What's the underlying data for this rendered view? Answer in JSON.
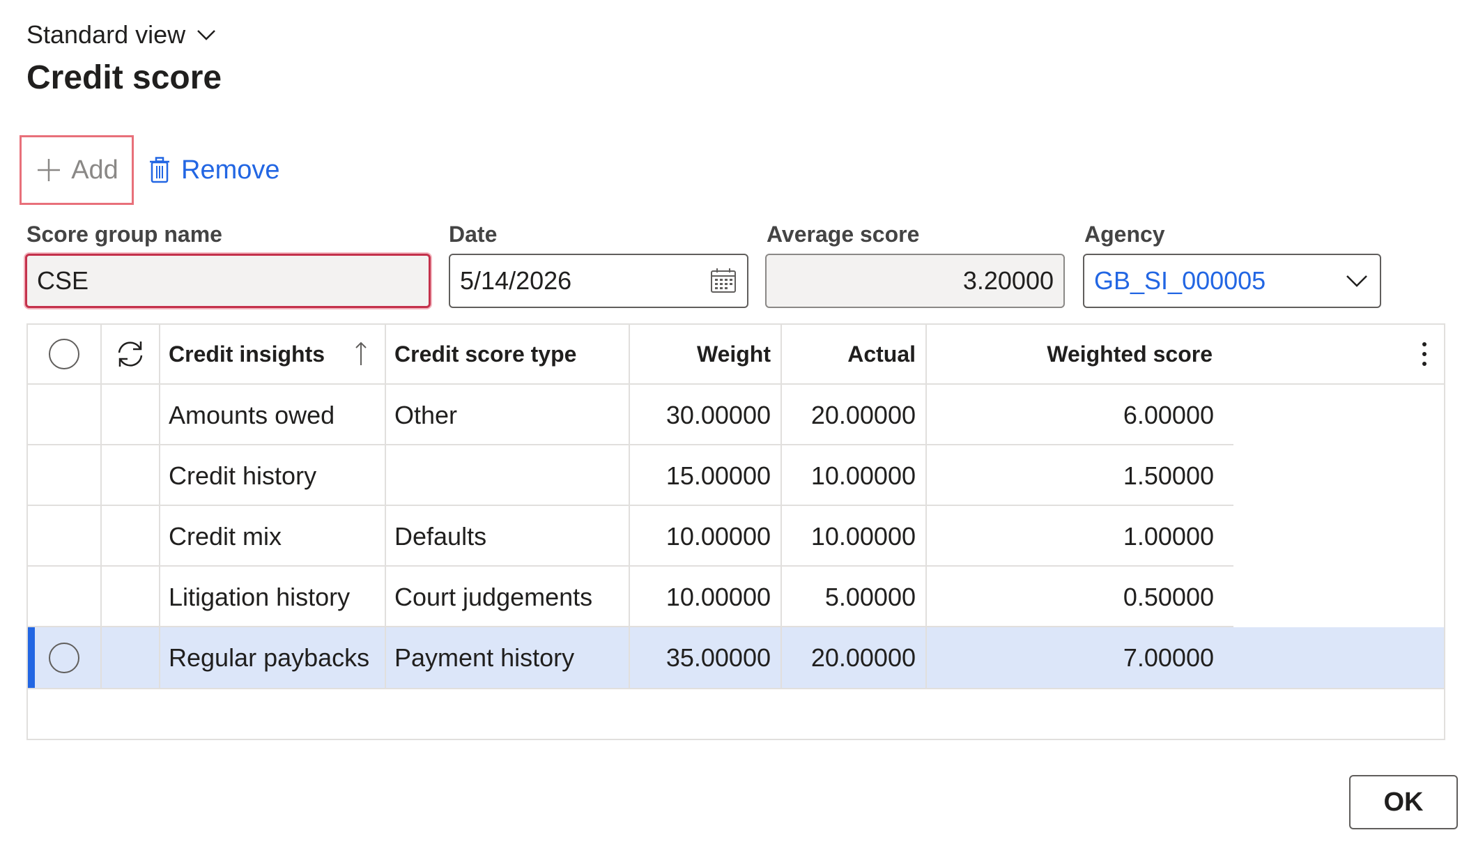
{
  "header": {
    "view_label": "Standard view",
    "title": "Credit score"
  },
  "toolbar": {
    "add_label": "Add",
    "remove_label": "Remove"
  },
  "fields": {
    "score_group_name": {
      "label": "Score group name",
      "value": "CSE"
    },
    "date": {
      "label": "Date",
      "value": "5/14/2026"
    },
    "average_score": {
      "label": "Average score",
      "value": "3.20000"
    },
    "agency": {
      "label": "Agency",
      "value": "GB_SI_000005"
    }
  },
  "grid": {
    "columns": {
      "credit_insights": "Credit insights",
      "credit_score_type": "Credit score type",
      "weight": "Weight",
      "actual": "Actual",
      "weighted_score": "Weighted score"
    },
    "sort_column": "credit_insights",
    "rows": [
      {
        "insight": "Amounts owed",
        "type": "Other",
        "weight": "30.00000",
        "actual": "20.00000",
        "weighted": "6.00000"
      },
      {
        "insight": "Credit history",
        "type": "",
        "weight": "15.00000",
        "actual": "10.00000",
        "weighted": "1.50000"
      },
      {
        "insight": "Credit mix",
        "type": "Defaults",
        "weight": "10.00000",
        "actual": "10.00000",
        "weighted": "1.00000"
      },
      {
        "insight": "Litigation history",
        "type": "Court judgements",
        "weight": "10.00000",
        "actual": "5.00000",
        "weighted": "0.50000"
      },
      {
        "insight": "Regular paybacks",
        "type": "Payment history",
        "weight": "35.00000",
        "actual": "20.00000",
        "weighted": "7.00000"
      }
    ],
    "selected_row": 4
  },
  "footer": {
    "ok_label": "OK"
  },
  "colors": {
    "accent": "#2266e3",
    "error_border": "#c4314b",
    "selected_row": "#dce6f9"
  }
}
